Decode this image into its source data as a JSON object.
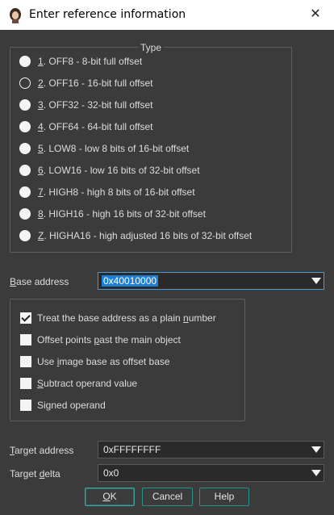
{
  "window": {
    "title": "Enter reference information"
  },
  "type_group": {
    "legend": "Type",
    "options": [
      {
        "num": "1",
        "rest": ". OFF8 - 8-bit full offset",
        "checked": false
      },
      {
        "num": "2",
        "rest": ". OFF16 - 16-bit full offset",
        "checked": true
      },
      {
        "num": "3",
        "rest": ". OFF32 - 32-bit full offset",
        "checked": false
      },
      {
        "num": "4",
        "rest": ". OFF64 - 64-bit full offset",
        "checked": false
      },
      {
        "num": "5",
        "rest": ". LOW8 - low 8 bits of 16-bit offset",
        "checked": false
      },
      {
        "num": "6",
        "rest": ". LOW16 - low 16 bits of 32-bit offset",
        "checked": false
      },
      {
        "num": "7",
        "rest": ". HIGH8 - high 8 bits of 16-bit offset",
        "checked": false
      },
      {
        "num": "8",
        "rest": ". HIGH16 - high 16 bits of 32-bit offset",
        "checked": false
      },
      {
        "num": "Z",
        "rest": ". HIGHA16 - high adjusted 16 bits of 32-bit offset",
        "checked": false
      }
    ]
  },
  "base_address": {
    "label_key": "B",
    "label_rest": "ase address",
    "value": "0x40010000"
  },
  "options": [
    {
      "pre": "Treat the base address as a plain ",
      "key": "n",
      "post": "umber",
      "checked": true
    },
    {
      "pre": "Offset points ",
      "key": "p",
      "post": "ast the main object",
      "checked": false
    },
    {
      "pre": "Use ",
      "key": "i",
      "post": "mage base as offset base",
      "checked": false
    },
    {
      "pre": "",
      "key": "S",
      "post": "ubtract operand value",
      "checked": false
    },
    {
      "pre": "Si",
      "key": "g",
      "post": "ned operand",
      "checked": false
    }
  ],
  "target_address": {
    "label_key": "T",
    "label_rest": "arget address",
    "value": "0xFFFFFFFF"
  },
  "target_delta": {
    "label_pre": "Target ",
    "label_key": "d",
    "label_rest": "elta",
    "value": "0x0"
  },
  "buttons": {
    "ok_key": "O",
    "ok_rest": "K",
    "cancel": "Cancel",
    "help": "Help"
  }
}
